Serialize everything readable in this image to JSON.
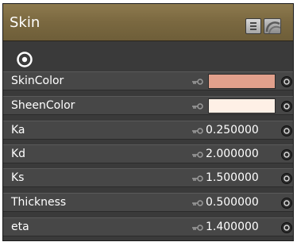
{
  "panel": {
    "title": "Skin",
    "title_gradient": [
      "#8d7a4e",
      "#6e5e39"
    ]
  },
  "toolbar": {
    "icons": [
      "list-icon",
      "swirl-icon"
    ]
  },
  "properties": [
    {
      "label": "SkinColor",
      "type": "color",
      "color": "#e1a08c"
    },
    {
      "label": "SheenColor",
      "type": "color",
      "color": "#fef0e6"
    },
    {
      "label": "Ka",
      "type": "number",
      "value": "0.250000"
    },
    {
      "label": "Kd",
      "type": "number",
      "value": "2.000000"
    },
    {
      "label": "Ks",
      "type": "number",
      "value": "1.500000"
    },
    {
      "label": "Thickness",
      "type": "number",
      "value": "0.500000"
    },
    {
      "label": "eta",
      "type": "number",
      "value": "1.400000"
    }
  ]
}
